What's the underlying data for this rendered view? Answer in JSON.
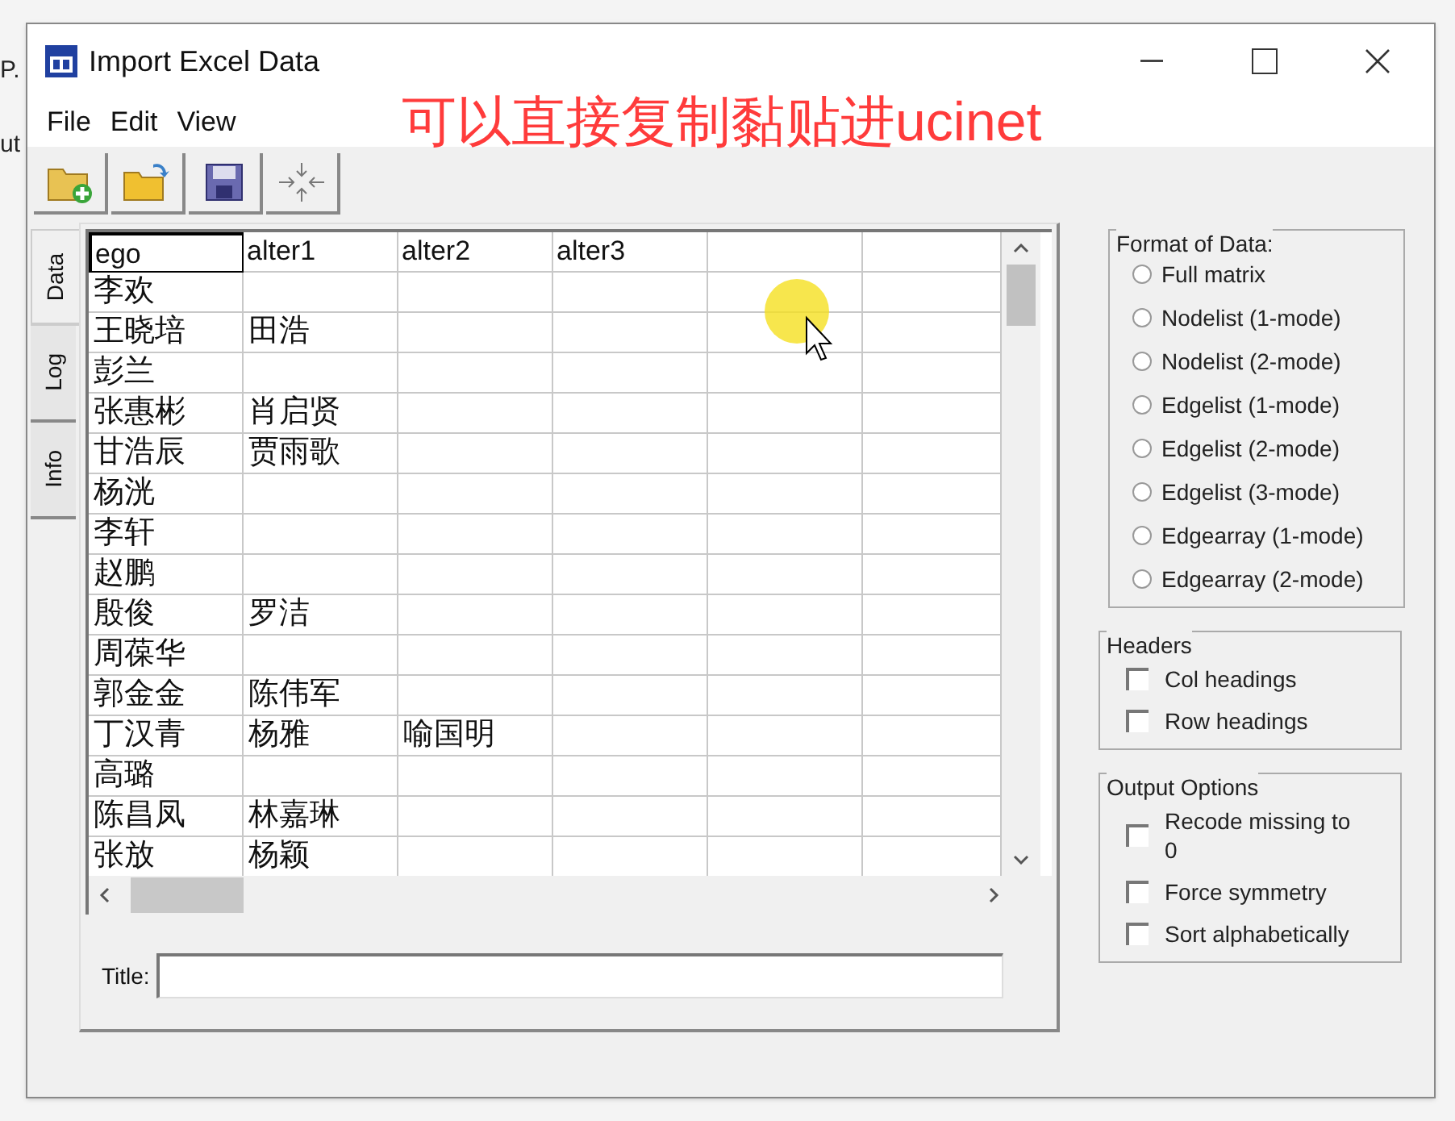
{
  "background_texts": [
    "P.",
    "ut"
  ],
  "window": {
    "title": "Import Excel Data"
  },
  "menu": [
    "File",
    "Edit",
    "View"
  ],
  "annotation": "可以直接复制黏贴进ucinet",
  "side_tabs": [
    {
      "label": "Data",
      "selected": true
    },
    {
      "label": "Log",
      "selected": false
    },
    {
      "label": "Info",
      "selected": false
    }
  ],
  "table": {
    "columns": [
      "ego",
      "alter1",
      "alter2",
      "alter3"
    ],
    "rows": [
      [
        "李欢"
      ],
      [
        "王晓培",
        "田浩"
      ],
      [
        "彭兰"
      ],
      [
        "张惠彬",
        "肖启贤"
      ],
      [
        "甘浩辰",
        "贾雨歌"
      ],
      [
        "杨洸"
      ],
      [
        "李轩"
      ],
      [
        "赵鹏"
      ],
      [
        "殷俊",
        "罗洁"
      ],
      [
        "周葆华"
      ],
      [
        "郭金金",
        "陈伟军"
      ],
      [
        "丁汉青",
        "杨雅",
        "喻国明"
      ],
      [
        "高璐"
      ],
      [
        "陈昌凤",
        "林嘉琳"
      ],
      [
        "张放",
        "杨颖"
      ]
    ]
  },
  "title_field": {
    "label": "Title:"
  },
  "format_of_data": {
    "title": "Format of Data:",
    "options": [
      {
        "label": "Full matrix",
        "selected": false
      },
      {
        "label": "Nodelist (1-mode)",
        "selected": false
      },
      {
        "label": "Nodelist (2-mode)",
        "selected": false
      },
      {
        "label": "Edgelist (1-mode)",
        "selected": false
      },
      {
        "label": "Edgelist (2-mode)",
        "selected": false
      },
      {
        "label": "Edgelist (3-mode)",
        "selected": false
      },
      {
        "label": "Edgearray (1-mode)",
        "selected": false
      },
      {
        "label": "Edgearray (2-mode)",
        "selected": false
      }
    ]
  },
  "headers": {
    "title": "Headers",
    "options": [
      {
        "label": "Col headings",
        "checked": false
      },
      {
        "label": "Row headings",
        "checked": false
      }
    ]
  },
  "output_options": {
    "title": "Output Options",
    "options": [
      {
        "label": "Recode missing to 0",
        "checked": false
      },
      {
        "label": "Force symmetry",
        "checked": false
      },
      {
        "label": "Sort alphabetically",
        "checked": false
      }
    ]
  }
}
